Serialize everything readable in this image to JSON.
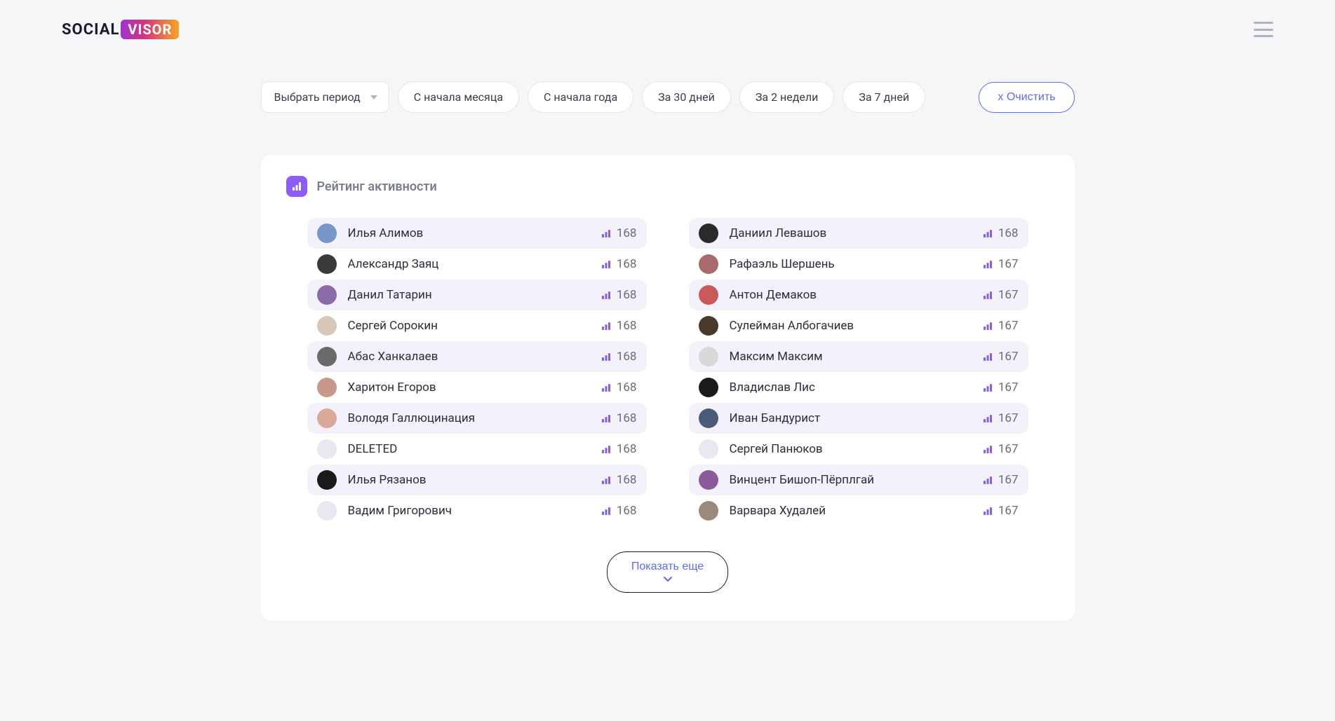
{
  "logo": {
    "social": "SOCIAL",
    "visor": "VISOR"
  },
  "filters": {
    "period_select": "Выбрать период",
    "chips": [
      "С начала месяца",
      "С начала года",
      "За 30 дней",
      "За 2 недели",
      "За 7 дней"
    ],
    "clear": "х Очистить"
  },
  "card": {
    "title": "Рейтинг активности",
    "show_more": "Показать еще"
  },
  "users_left": [
    {
      "name": "Илья Алимов",
      "score": "168",
      "avatar": "#7896c8"
    },
    {
      "name": "Александр Заяц",
      "score": "168",
      "avatar": "#3a3a3a"
    },
    {
      "name": "Данил Татарин",
      "score": "168",
      "avatar": "#8a6aa8"
    },
    {
      "name": "Сергей Сорокин",
      "score": "168",
      "avatar": "#d8c8b8"
    },
    {
      "name": "Абас Ханкалаев",
      "score": "168",
      "avatar": "#6a6a6a"
    },
    {
      "name": "Харитон Егоров",
      "score": "168",
      "avatar": "#c8988a"
    },
    {
      "name": "Володя Галлюцинация",
      "score": "168",
      "avatar": "#d8a898"
    },
    {
      "name": "DELETED",
      "score": "168",
      "avatar": "#e8e8f0"
    },
    {
      "name": "Илья Рязанов",
      "score": "168",
      "avatar": "#1a1a1a"
    },
    {
      "name": "Вадим Григорович",
      "score": "168",
      "avatar": "#e8e8f0"
    }
  ],
  "users_right": [
    {
      "name": "Даниил Левашов",
      "score": "168",
      "avatar": "#2a2a2a"
    },
    {
      "name": "Рафаэль Шершень",
      "score": "167",
      "avatar": "#a86a6a"
    },
    {
      "name": "Антон Демаков",
      "score": "167",
      "avatar": "#c85a5a"
    },
    {
      "name": "Сулейман Албогачиев",
      "score": "167",
      "avatar": "#4a3a2a"
    },
    {
      "name": "Максим Максим",
      "score": "167",
      "avatar": "#d8d8d8"
    },
    {
      "name": "Владислав Лис",
      "score": "167",
      "avatar": "#1a1a1a"
    },
    {
      "name": "Иван Бандурист",
      "score": "167",
      "avatar": "#4a5a7a"
    },
    {
      "name": "Сергей Панюков",
      "score": "167",
      "avatar": "#e8e8f0"
    },
    {
      "name": "Винцент Бишоп-Пёрплгай",
      "score": "167",
      "avatar": "#8a5a9a"
    },
    {
      "name": "Варвара Худалей",
      "score": "167",
      "avatar": "#9a8a7a"
    }
  ]
}
